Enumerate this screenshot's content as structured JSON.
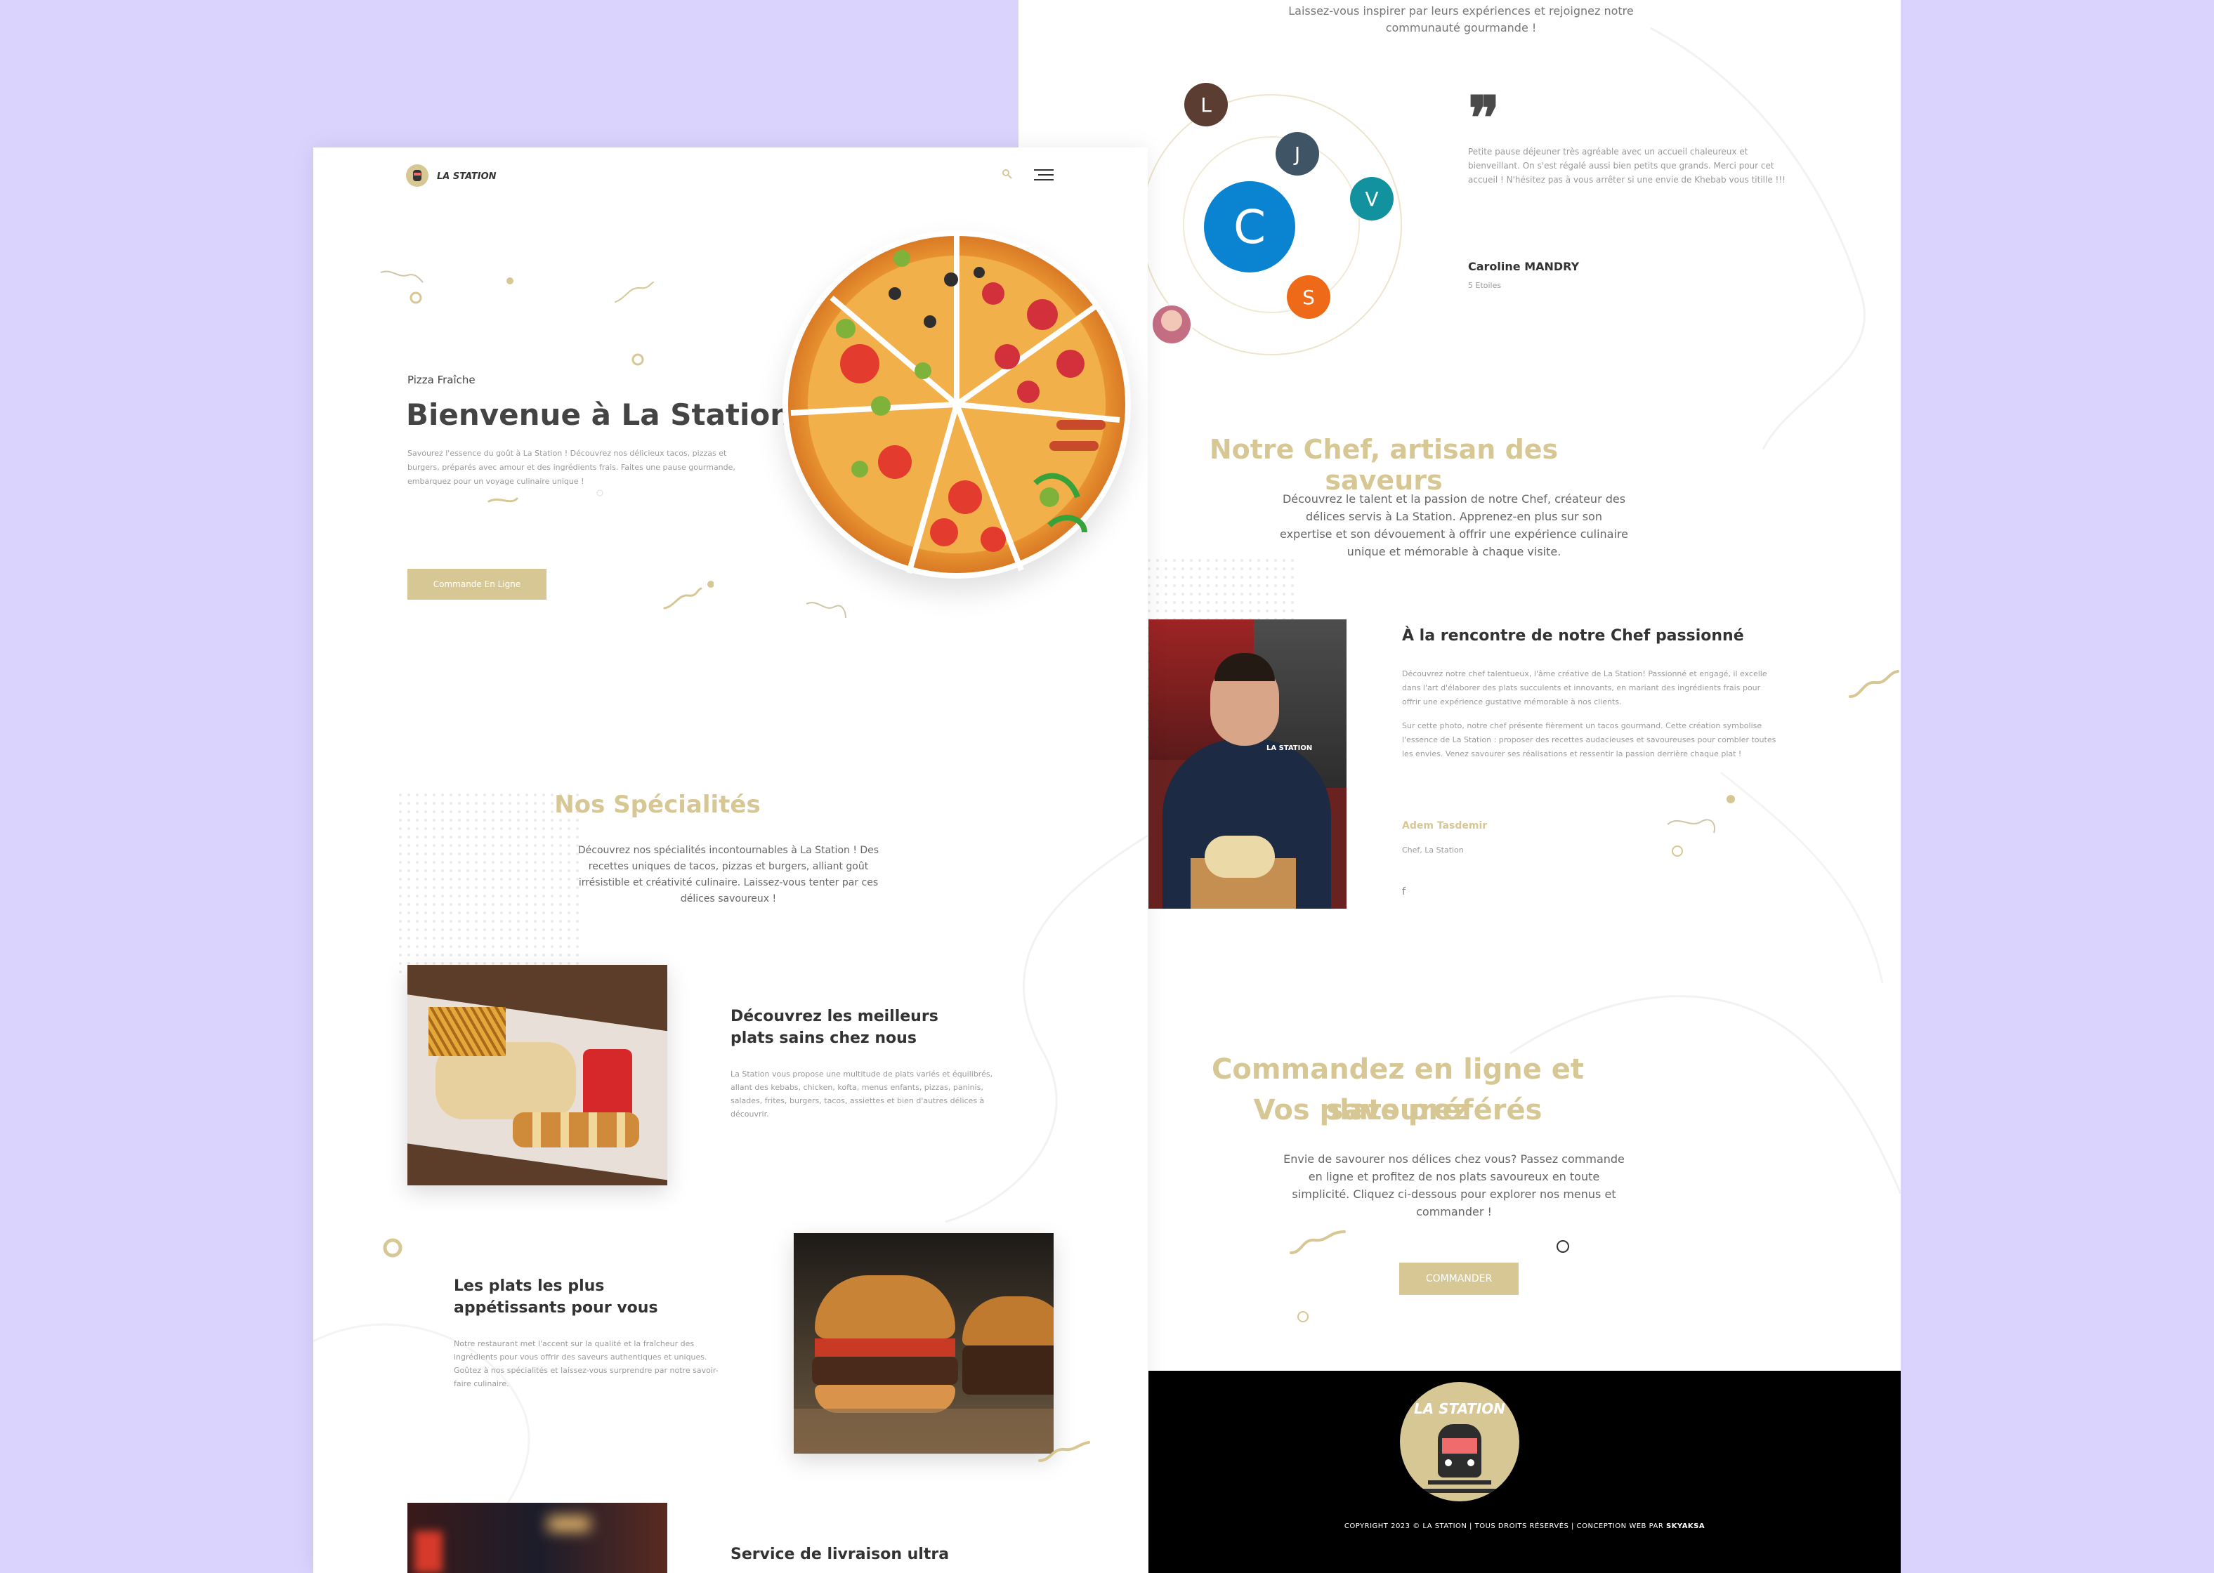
{
  "right": {
    "testimonial_intro": "Laissez-vous inspirer par leurs expériences et rejoignez notre communauté gourmande !",
    "avatars": [
      {
        "letter": "L",
        "color": "#5c3d32"
      },
      {
        "letter": "J",
        "color": "#3f5566"
      },
      {
        "letter": "V",
        "color": "#11929e"
      },
      {
        "letter": "C",
        "color": "#0a84d0"
      },
      {
        "letter": "S",
        "color": "#ee6a19"
      },
      {
        "letter": "C",
        "color": "#0a84d0"
      }
    ],
    "quote_text": "Petite pause déjeuner très agréable avec un accueil chaleureux et bienveillant. On s'est régalé aussi bien petits que grands. Merci pour cet accueil ! N'hésitez pas à vous arrêter si une envie de Khebab vous titille !!!",
    "reviewer_name": "Caroline MANDRY",
    "reviewer_rating": "5 Etoiles",
    "chef_title": "Notre Chef, artisan des saveurs",
    "chef_intro": "Découvrez le talent et la passion de notre Chef, créateur des délices servis à La Station. Apprenez-en plus sur son expertise et son dévouement à offrir une expérience culinaire unique et mémorable à chaque visite.",
    "chef_heading": "À la rencontre de notre Chef passionné",
    "chef_p1": "Découvrez notre chef talentueux, l'âme créative de La Station! Passionné et engagé, il excelle dans l'art d'élaborer des plats succulents et innovants, en mariant des ingrédients frais pour offrir une expérience gustative mémorable à nos clients.",
    "chef_p2": "Sur cette photo, notre chef présente fièrement un tacos gourmand. Cette création symbolise l'essence de La Station : proposer des recettes audacieuses et savoureuses pour combler toutes les envies. Venez savourer ses réalisations et ressentir la passion derrière chaque plat !",
    "chef_name": "Adem Tasdemir",
    "chef_role": "Chef, La Station",
    "chef_social": "f",
    "chef_shirt": "LA STATION",
    "order_title_1": "Commandez en ligne et savourez",
    "order_title_2": "Vos plats préférés",
    "order_text": "Envie de savourer nos délices chez vous? Passez commande en ligne et profitez de nos plats savoureux en toute simplicité. Cliquez ci-dessous pour explorer nos menus et commander !",
    "order_button": "COMMANDER",
    "footer_logo_text": "LA STATION",
    "footer_copyright": "COPYRIGHT 2023 © LA STATION | TOUS DROITS RÉSERVÉS | CONCEPTION WEB PAR ",
    "footer_credit": "SKYAKSA"
  },
  "left": {
    "logo_text": "LA STATION",
    "hero_eyebrow": "Pizza Fraîche",
    "hero_title": "Bienvenue à La Station",
    "hero_text": "Savourez l'essence du goût à La Station ! Découvrez nos délicieux tacos, pizzas et burgers, préparés avec amour et des ingrédients frais. Faites une pause gourmande, embarquez pour un voyage culinaire unique !",
    "hero_button": "Commande En Ligne",
    "spec_title": "Nos Spécialités",
    "spec_intro": "Découvrez nos spécialités incontournables à La Station ! Des recettes uniques de tacos, pizzas et burgers, alliant goût irrésistible et créativité culinaire. Laissez-vous tenter par ces délices savoureux !",
    "item1_title_1": "Découvrez les meilleurs",
    "item1_title_2": "plats sains chez nous",
    "item1_text": "La Station vous propose une multitude de plats variés et équilibrés, allant des kebabs, chicken, kofta, menus enfants, pizzas, paninis, salades, frites, burgers, tacos, assiettes et bien d'autres délices à découvrir.",
    "item2_title_1": "Les plats les plus",
    "item2_title_2": "appétissants pour vous",
    "item2_text": "Notre restaurant met l'accent sur la qualité et la fraîcheur des ingrédients pour vous offrir des saveurs authentiques et uniques. Goûtez à nos spécialités et laissez-vous surprendre par notre savoir-faire culinaire.",
    "item3_title": "Service de livraison ultra"
  },
  "colors": {
    "background": "#d9d3fd",
    "accent_gold": "#d7c795",
    "footer_bg": "#000000"
  }
}
